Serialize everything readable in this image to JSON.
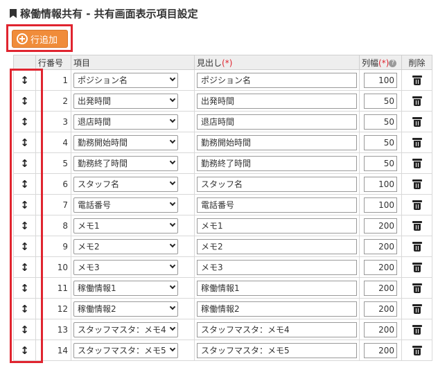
{
  "page": {
    "title": "稼働情報共有 - 共有画面表示項目設定"
  },
  "toolbar": {
    "add_row_label": "行追加"
  },
  "table": {
    "headers": {
      "row_no": "行番号",
      "item": "項目",
      "heading": "見出し",
      "required_mark": "(*)",
      "width": "列幅",
      "width_required": "(*)",
      "help": "?",
      "delete": "削除"
    },
    "rows": [
      {
        "no": "1",
        "item": "ポジション名",
        "heading": "ポジション名",
        "width": "100"
      },
      {
        "no": "2",
        "item": "出発時間",
        "heading": "出発時間",
        "width": "50"
      },
      {
        "no": "3",
        "item": "退店時間",
        "heading": "退店時間",
        "width": "50"
      },
      {
        "no": "4",
        "item": "勤務開始時間",
        "heading": "勤務開始時間",
        "width": "50"
      },
      {
        "no": "5",
        "item": "勤務終了時間",
        "heading": "勤務終了時間",
        "width": "50"
      },
      {
        "no": "6",
        "item": "スタッフ名",
        "heading": "スタッフ名",
        "width": "100"
      },
      {
        "no": "7",
        "item": "電話番号",
        "heading": "電話番号",
        "width": "100"
      },
      {
        "no": "8",
        "item": "メモ1",
        "heading": "メモ1",
        "width": "200"
      },
      {
        "no": "9",
        "item": "メモ2",
        "heading": "メモ2",
        "width": "200"
      },
      {
        "no": "10",
        "item": "メモ3",
        "heading": "メモ3",
        "width": "200"
      },
      {
        "no": "11",
        "item": "稼働情報1",
        "heading": "稼働情報1",
        "width": "200"
      },
      {
        "no": "12",
        "item": "稼働情報2",
        "heading": "稼働情報2",
        "width": "200"
      },
      {
        "no": "13",
        "item": "スタッフマスタ：メモ4",
        "heading": "スタッフマスタ：メモ4",
        "width": "200"
      },
      {
        "no": "14",
        "item": "スタッフマスタ：メモ5",
        "heading": "スタッフマスタ：メモ5",
        "width": "200"
      }
    ]
  },
  "colors": {
    "accent": "#f08c3a",
    "highlight": "#e0242f",
    "header_bg": "#eeeeee"
  },
  "icons": {
    "drag": "drag-handle-icon",
    "delete": "trash-icon",
    "add": "plus-circle-icon",
    "title": "bookmark-icon"
  }
}
